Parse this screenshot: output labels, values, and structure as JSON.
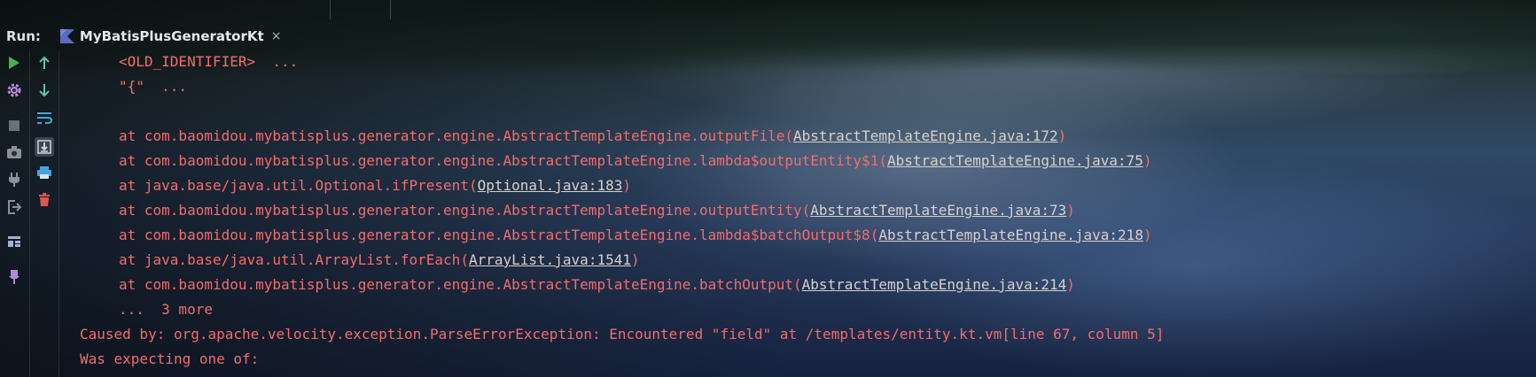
{
  "header": {
    "run_label": "Run:",
    "tab_label": "MyBatisPlusGeneratorKt",
    "tab_close": "×"
  },
  "toolbar_left": [
    "run-icon",
    "settings-icon",
    "stop-icon",
    "camera-icon",
    "plug-icon",
    "exit-icon",
    "layout-icon",
    "pin-icon"
  ],
  "toolbar_right": [
    "up-arrow-icon",
    "down-arrow-icon",
    "soft-wrap-icon",
    "scroll-to-end-icon",
    "print-icon",
    "trash-icon"
  ],
  "colors": {
    "error_text": "#f36c6c",
    "link_text": "#d8d0cc",
    "run_green": "#4caf50",
    "gear_purple": "#b48ad8",
    "toolbar_blue": "#4aa3d8",
    "trash_red": "#e05555"
  },
  "console": {
    "lines": [
      {
        "pre": "<OLD_IDENTIFIER>  ...",
        "link": "",
        "post": "",
        "indent": true
      },
      {
        "pre": "\"{\"  ...",
        "link": "",
        "post": "",
        "indent": true
      },
      {
        "pre": "",
        "link": "",
        "post": "",
        "indent": true
      },
      {
        "pre": "at com.baomidou.mybatisplus.generator.engine.AbstractTemplateEngine.outputFile(",
        "link": "AbstractTemplateEngine.java:172",
        "post": ")",
        "indent": true
      },
      {
        "pre": "at com.baomidou.mybatisplus.generator.engine.AbstractTemplateEngine.lambda$outputEntity$1(",
        "link": "AbstractTemplateEngine.java:75",
        "post": ")",
        "indent": true
      },
      {
        "pre": "at java.base/java.util.Optional.ifPresent(",
        "link": "Optional.java:183",
        "post": ")",
        "indent": true
      },
      {
        "pre": "at com.baomidou.mybatisplus.generator.engine.AbstractTemplateEngine.outputEntity(",
        "link": "AbstractTemplateEngine.java:73",
        "post": ")",
        "indent": true
      },
      {
        "pre": "at com.baomidou.mybatisplus.generator.engine.AbstractTemplateEngine.lambda$batchOutput$8(",
        "link": "AbstractTemplateEngine.java:218",
        "post": ")",
        "indent": true
      },
      {
        "pre": "at java.base/java.util.ArrayList.forEach(",
        "link": "ArrayList.java:1541",
        "post": ")",
        "indent": true
      },
      {
        "pre": "at com.baomidou.mybatisplus.generator.engine.AbstractTemplateEngine.batchOutput(",
        "link": "AbstractTemplateEngine.java:214",
        "post": ")",
        "indent": true
      },
      {
        "pre": "...  3 more",
        "link": "",
        "post": "",
        "indent": true
      },
      {
        "pre": "Caused by: org.apache.velocity.exception.ParseErrorException: Encountered \"field\" at /templates/entity.kt.vm[line 67, column 5]",
        "link": "",
        "post": "",
        "indent": false
      },
      {
        "pre": "Was expecting one of:",
        "link": "",
        "post": "",
        "indent": false
      }
    ]
  }
}
